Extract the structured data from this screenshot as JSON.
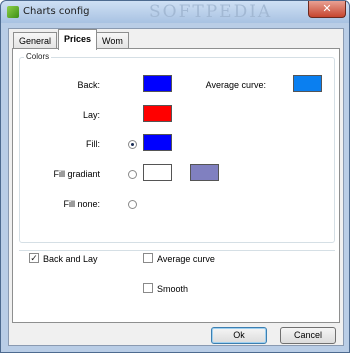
{
  "window": {
    "title": "Charts config",
    "watermark": "SOFTPEDIA",
    "close_glyph": "✕"
  },
  "tabs": [
    {
      "label": "General",
      "active": false
    },
    {
      "label": "Prices",
      "active": true
    },
    {
      "label": "Wom",
      "active": false
    }
  ],
  "colors_group": {
    "label": "Colors",
    "back_label": "Back:",
    "average_curve_label": "Average curve:",
    "lay_label": "Lay:",
    "fill_label": "Fill:",
    "fill_gradient_label": "Fill gradiant",
    "fill_none_label": "Fill none:",
    "swatches": {
      "back": "#0000ff",
      "average_curve": "#0a7ff0",
      "lay": "#ff0000",
      "fill": "#0000ff",
      "gradient_start": "#ffffff",
      "gradient_end": "#8080c0"
    },
    "fill_mode_selected": "fill"
  },
  "options": {
    "back_and_lay": {
      "label": "Back and Lay",
      "checked": true
    },
    "average_curve": {
      "label": "Average curve",
      "checked": false
    },
    "smooth": {
      "label": "Smooth",
      "checked": false
    }
  },
  "buttons": {
    "ok": "Ok",
    "cancel": "Cancel"
  },
  "icons": {
    "app": "chart-app-icon",
    "check": "✓"
  }
}
